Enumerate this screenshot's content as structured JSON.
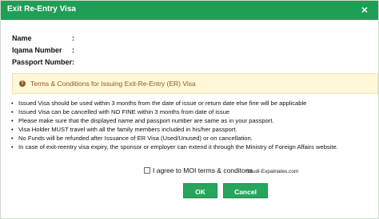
{
  "dialog": {
    "title": "Exit Re-Entry Visa",
    "close_icon": "×"
  },
  "fields": [
    {
      "label": "Name",
      "colon": ":",
      "value": ""
    },
    {
      "label": "Iqama Number",
      "colon": ":",
      "value": ""
    },
    {
      "label": "Passport Number",
      "colon": ":",
      "value": ""
    }
  ],
  "terms": {
    "icon": "!",
    "title": "Terms & Conditions for Issuing Exit-Re-Entry (ER) Visa",
    "bullet": "•",
    "items": [
      "Issued Visa should be used within 3 months from the date of issue or return date else fine will be applicable",
      "Issued Visa can be cancelled with NO FINE within 3 months from date of issue",
      "Please make sure that the displayed name and passport number are same as in your passport.",
      "Visa Holder MUST travel with all the family members included in his/her passport.",
      "No Funds will be refunded after Issuance of ER Visa (Used/Unused) or on cancellation.",
      "In case of exit-reentry visa expiry, the sponsor or employer can extend it through the Ministry of Foreign Affairs website."
    ]
  },
  "agreement": {
    "label": "I agree to MOI terms & conditons",
    "checked": false
  },
  "watermark": "Saudi-Expatriates.com",
  "buttons": {
    "ok": "OK",
    "cancel": "Cancel"
  },
  "colors": {
    "header": "#1f9f55",
    "button": "#28a55d",
    "terms_background": "#fff7d8",
    "terms_text": "#8f5b1d"
  }
}
